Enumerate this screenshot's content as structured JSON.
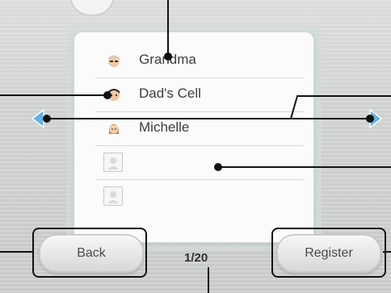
{
  "contacts": [
    {
      "name": "Grandma",
      "avatar": "mii-grandma-icon"
    },
    {
      "name": "Dad's Cell",
      "avatar": "mii-dad-icon"
    },
    {
      "name": "Michelle",
      "avatar": "mii-michelle-icon"
    },
    {
      "name": "",
      "avatar": "empty-slot-icon"
    },
    {
      "name": "",
      "avatar": "empty-slot-icon"
    }
  ],
  "buttons": {
    "back": "Back",
    "register": "Register"
  },
  "pagination": {
    "page": "1/20"
  },
  "colors": {
    "arrow": "#5fb3e6",
    "callout": "#111111"
  }
}
